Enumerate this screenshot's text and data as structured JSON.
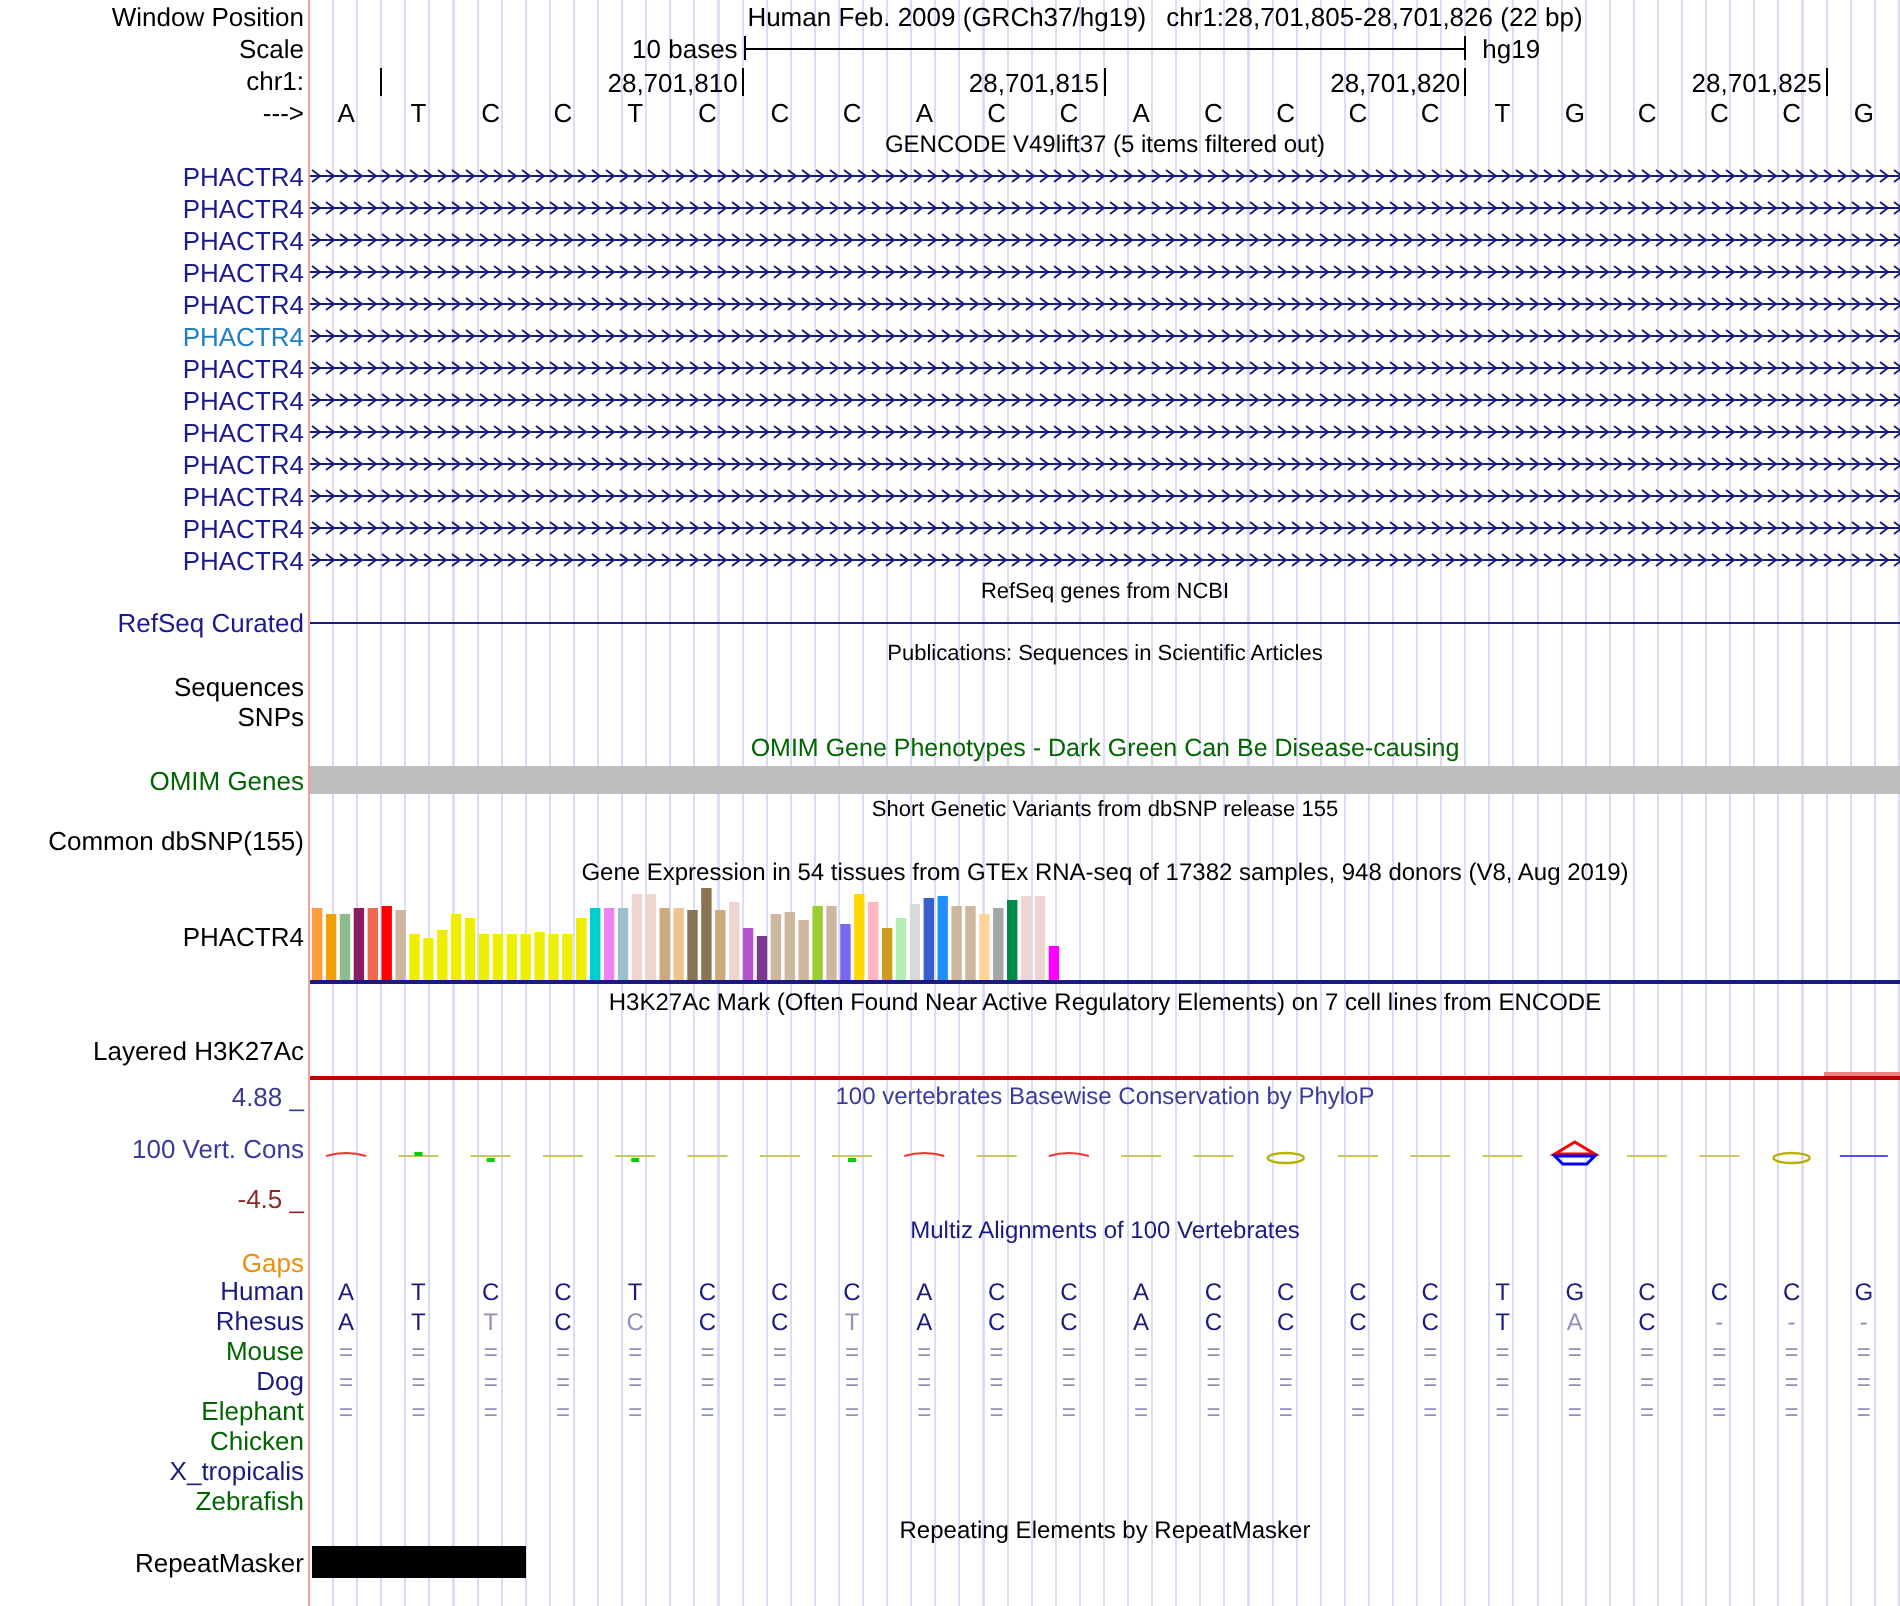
{
  "header": {
    "window_position_label": "Window Position",
    "scale_label": "Scale",
    "chrom_label": "chr1:",
    "strand_label": "--->",
    "assembly": "Human Feb. 2009 (GRCh37/hg19)",
    "position": "chr1:28,701,805-28,701,826 (22 bp)",
    "scale_text": "10 bases",
    "scale_db": "hg19",
    "ticks": [
      "28,701,810",
      "28,701,815",
      "28,701,820",
      "28,701,825"
    ],
    "bases": [
      "A",
      "T",
      "C",
      "C",
      "T",
      "C",
      "C",
      "C",
      "A",
      "C",
      "C",
      "A",
      "C",
      "C",
      "C",
      "C",
      "T",
      "G",
      "C",
      "C",
      "C",
      "G"
    ]
  },
  "gencode": {
    "title": "GENCODE V49lift37 (5 items filtered out)",
    "rows": [
      {
        "label": "PHACTR4",
        "highlighted": false
      },
      {
        "label": "PHACTR4",
        "highlighted": false
      },
      {
        "label": "PHACTR4",
        "highlighted": false
      },
      {
        "label": "PHACTR4",
        "highlighted": false
      },
      {
        "label": "PHACTR4",
        "highlighted": false
      },
      {
        "label": "PHACTR4",
        "highlighted": true
      },
      {
        "label": "PHACTR4",
        "highlighted": false
      },
      {
        "label": "PHACTR4",
        "highlighted": false
      },
      {
        "label": "PHACTR4",
        "highlighted": false
      },
      {
        "label": "PHACTR4",
        "highlighted": false
      },
      {
        "label": "PHACTR4",
        "highlighted": false
      },
      {
        "label": "PHACTR4",
        "highlighted": false
      },
      {
        "label": "PHACTR4",
        "highlighted": false
      }
    ]
  },
  "refseq": {
    "title": "RefSeq genes from NCBI",
    "label": "RefSeq Curated"
  },
  "publications": {
    "title": "Publications: Sequences in Scientific Articles",
    "labels": [
      "Sequences",
      "SNPs"
    ]
  },
  "omim": {
    "title": "OMIM Gene Phenotypes - Dark Green Can Be Disease-causing",
    "label": "OMIM Genes"
  },
  "dbsnp": {
    "title": "Short Genetic Variants from dbSNP release 155",
    "label": "Common dbSNP(155)"
  },
  "gtex": {
    "title": "Gene Expression in 54 tissues from GTEx RNA-seq of 17382 samples, 948 donors (V8, Aug 2019)",
    "label": "PHACTR4"
  },
  "h3k27ac": {
    "title": "H3K27Ac Mark (Often Found Near Active Regulatory Elements) on 7 cell lines from ENCODE",
    "label": "Layered H3K27Ac"
  },
  "phylop": {
    "title": "100 vertebrates Basewise Conservation by PhyloP",
    "label": "100 Vert. Cons",
    "max_label": "4.88 _",
    "min_label": "-4.5 _"
  },
  "multiz": {
    "title": "Multiz Alignments of 100 Vertebrates",
    "gaps_label": "Gaps",
    "species": [
      {
        "name": "Human",
        "color": "#1a1a80",
        "bases": [
          {
            "text": "A",
            "dim": false
          },
          {
            "text": "T",
            "dim": false
          },
          {
            "text": "C",
            "dim": false
          },
          {
            "text": "C",
            "dim": false
          },
          {
            "text": "T",
            "dim": false
          },
          {
            "text": "C",
            "dim": false
          },
          {
            "text": "C",
            "dim": false
          },
          {
            "text": "C",
            "dim": false
          },
          {
            "text": "A",
            "dim": false
          },
          {
            "text": "C",
            "dim": false
          },
          {
            "text": "C",
            "dim": false
          },
          {
            "text": "A",
            "dim": false
          },
          {
            "text": "C",
            "dim": false
          },
          {
            "text": "C",
            "dim": false
          },
          {
            "text": "C",
            "dim": false
          },
          {
            "text": "C",
            "dim": false
          },
          {
            "text": "T",
            "dim": false
          },
          {
            "text": "G",
            "dim": false
          },
          {
            "text": "C",
            "dim": false
          },
          {
            "text": "C",
            "dim": false
          },
          {
            "text": "C",
            "dim": false
          },
          {
            "text": "G",
            "dim": false
          }
        ]
      },
      {
        "name": "Rhesus",
        "color": "#1a1a80",
        "bases": [
          {
            "text": "A",
            "dim": false
          },
          {
            "text": "T",
            "dim": false
          },
          {
            "text": "T",
            "dim": true
          },
          {
            "text": "C",
            "dim": false
          },
          {
            "text": "C",
            "dim": true
          },
          {
            "text": "C",
            "dim": false
          },
          {
            "text": "C",
            "dim": false
          },
          {
            "text": "T",
            "dim": true
          },
          {
            "text": "A",
            "dim": false
          },
          {
            "text": "C",
            "dim": false
          },
          {
            "text": "C",
            "dim": false
          },
          {
            "text": "A",
            "dim": false
          },
          {
            "text": "C",
            "dim": false
          },
          {
            "text": "C",
            "dim": false
          },
          {
            "text": "C",
            "dim": false
          },
          {
            "text": "C",
            "dim": false
          },
          {
            "text": "T",
            "dim": false
          },
          {
            "text": "A",
            "dim": true
          },
          {
            "text": "C",
            "dim": false
          },
          {
            "text": "-",
            "dim": true
          },
          {
            "text": "-",
            "dim": true
          },
          {
            "text": "-",
            "dim": true
          }
        ]
      },
      {
        "name": "Mouse",
        "color": "#006400",
        "bases": [
          {
            "text": "=",
            "dim": true
          },
          {
            "text": "=",
            "dim": true
          },
          {
            "text": "=",
            "dim": true
          },
          {
            "text": "=",
            "dim": true
          },
          {
            "text": "=",
            "dim": true
          },
          {
            "text": "=",
            "dim": true
          },
          {
            "text": "=",
            "dim": true
          },
          {
            "text": "=",
            "dim": true
          },
          {
            "text": "=",
            "dim": true
          },
          {
            "text": "=",
            "dim": true
          },
          {
            "text": "=",
            "dim": true
          },
          {
            "text": "=",
            "dim": true
          },
          {
            "text": "=",
            "dim": true
          },
          {
            "text": "=",
            "dim": true
          },
          {
            "text": "=",
            "dim": true
          },
          {
            "text": "=",
            "dim": true
          },
          {
            "text": "=",
            "dim": true
          },
          {
            "text": "=",
            "dim": true
          },
          {
            "text": "=",
            "dim": true
          },
          {
            "text": "=",
            "dim": true
          },
          {
            "text": "=",
            "dim": true
          },
          {
            "text": "=",
            "dim": true
          }
        ]
      },
      {
        "name": "Dog",
        "color": "#1a1a80",
        "bases": [
          {
            "text": "=",
            "dim": true
          },
          {
            "text": "=",
            "dim": true
          },
          {
            "text": "=",
            "dim": true
          },
          {
            "text": "=",
            "dim": true
          },
          {
            "text": "=",
            "dim": true
          },
          {
            "text": "=",
            "dim": true
          },
          {
            "text": "=",
            "dim": true
          },
          {
            "text": "=",
            "dim": true
          },
          {
            "text": "=",
            "dim": true
          },
          {
            "text": "=",
            "dim": true
          },
          {
            "text": "=",
            "dim": true
          },
          {
            "text": "=",
            "dim": true
          },
          {
            "text": "=",
            "dim": true
          },
          {
            "text": "=",
            "dim": true
          },
          {
            "text": "=",
            "dim": true
          },
          {
            "text": "=",
            "dim": true
          },
          {
            "text": "=",
            "dim": true
          },
          {
            "text": "=",
            "dim": true
          },
          {
            "text": "=",
            "dim": true
          },
          {
            "text": "=",
            "dim": true
          },
          {
            "text": "=",
            "dim": true
          },
          {
            "text": "=",
            "dim": true
          }
        ]
      },
      {
        "name": "Elephant",
        "color": "#006400",
        "bases": [
          {
            "text": "=",
            "dim": true
          },
          {
            "text": "=",
            "dim": true
          },
          {
            "text": "=",
            "dim": true
          },
          {
            "text": "=",
            "dim": true
          },
          {
            "text": "=",
            "dim": true
          },
          {
            "text": "=",
            "dim": true
          },
          {
            "text": "=",
            "dim": true
          },
          {
            "text": "=",
            "dim": true
          },
          {
            "text": "=",
            "dim": true
          },
          {
            "text": "=",
            "dim": true
          },
          {
            "text": "=",
            "dim": true
          },
          {
            "text": "=",
            "dim": true
          },
          {
            "text": "=",
            "dim": true
          },
          {
            "text": "=",
            "dim": true
          },
          {
            "text": "=",
            "dim": true
          },
          {
            "text": "=",
            "dim": true
          },
          {
            "text": "=",
            "dim": true
          },
          {
            "text": "=",
            "dim": true
          },
          {
            "text": "=",
            "dim": true
          },
          {
            "text": "=",
            "dim": true
          },
          {
            "text": "=",
            "dim": true
          },
          {
            "text": "=",
            "dim": true
          }
        ]
      },
      {
        "name": "Chicken",
        "color": "#006400"
      },
      {
        "name": "X_tropicalis",
        "color": "#1a1a80"
      },
      {
        "name": "Zebrafish",
        "color": "#006400"
      }
    ]
  },
  "repeatmasker": {
    "title": "Repeating Elements by RepeatMasker",
    "label": "RepeatMasker"
  }
}
